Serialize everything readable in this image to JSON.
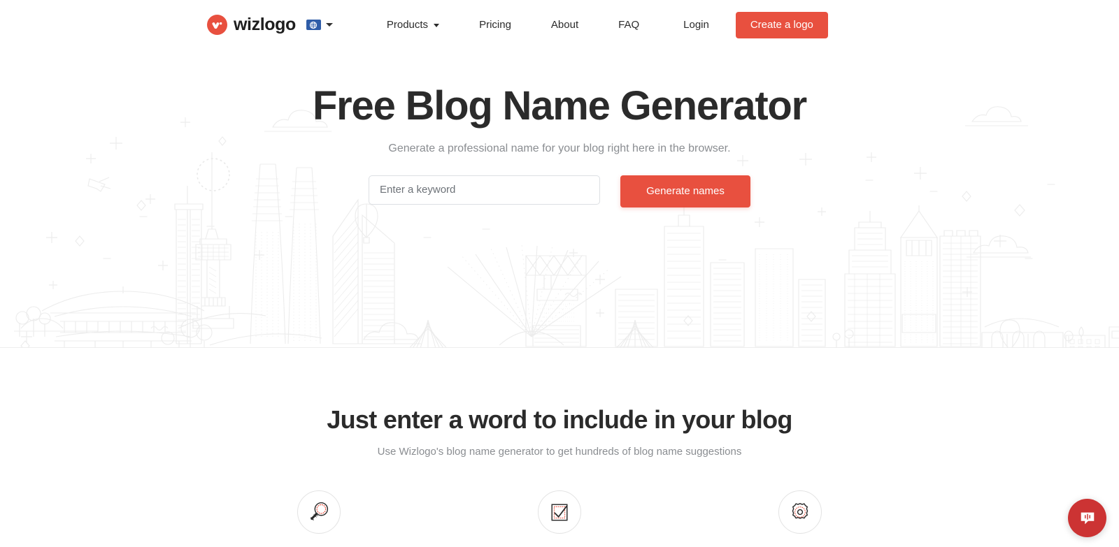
{
  "header": {
    "brand_name": "wizlogo",
    "brand_mark_icon": "wizlogo-w-mark",
    "language_icon": "globe-icon",
    "language_caret_icon": "chevron-down-icon",
    "nav": [
      {
        "label": "Products",
        "has_caret": true,
        "icon": "chevron-down-icon"
      },
      {
        "label": "Pricing",
        "has_caret": false
      },
      {
        "label": "About",
        "has_caret": false
      },
      {
        "label": "FAQ",
        "has_caret": false
      }
    ],
    "login_label": "Login",
    "cta_label": "Create a logo"
  },
  "hero": {
    "title": "Free Blog Name Generator",
    "subtitle": "Generate a professional name for your blog right here in the browser.",
    "input_placeholder": "Enter a keyword",
    "input_value": "",
    "button_label": "Generate names",
    "background_illustration": "city-skyline-line-art"
  },
  "features": {
    "title": "Just enter a word to include in your blog",
    "subtitle": "Use Wizlogo's blog name generator to get hundreds of blog name suggestions",
    "items": [
      {
        "icon": "magnifier-icon"
      },
      {
        "icon": "checkbox-check-icon"
      },
      {
        "icon": "gear-icon"
      }
    ]
  },
  "chat_widget": {
    "icon": "chat-bubble-waveform-icon",
    "label": "Open chat"
  },
  "colors": {
    "brand_red": "#e8503f",
    "chat_red": "#cc3333",
    "flag_blue": "#2f5da8",
    "text_dark": "#2b2b2b",
    "text_muted": "#8a8d91",
    "illustration_gray": "#ededed",
    "accent_dots_red": "#e8503f"
  }
}
